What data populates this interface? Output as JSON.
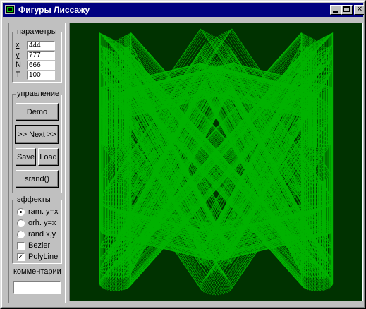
{
  "window": {
    "title": "Фигуры Лиссажу",
    "controls": [
      "minimize",
      "maximize",
      "close"
    ]
  },
  "params": {
    "group_label": "параметры",
    "fields": [
      {
        "label": "x",
        "value": "444"
      },
      {
        "label": "y",
        "value": "777"
      },
      {
        "label": "N",
        "value": "666"
      },
      {
        "label": "T",
        "value": "100"
      }
    ]
  },
  "control": {
    "group_label": "управление",
    "demo_label": "Demo",
    "next_label": ">> Next >>",
    "save_label": "Save",
    "load_label": "Load",
    "srand_label": "srand()"
  },
  "effects": {
    "group_label": "эффекты",
    "options": [
      {
        "label": "ram. y=x",
        "kind": "radio",
        "checked": true
      },
      {
        "label": "orh. y=x",
        "kind": "radio",
        "checked": false
      },
      {
        "label": "rand x,y",
        "kind": "radio",
        "checked": false
      },
      {
        "label": "Bezier",
        "kind": "checkbox",
        "checked": false
      },
      {
        "label": "PolyLine",
        "kind": "checkbox",
        "checked": true
      }
    ]
  },
  "comment": {
    "group_label": "комментарии",
    "value": ""
  },
  "figure": {
    "background_color": "#003200",
    "line_color": "#00c000"
  }
}
